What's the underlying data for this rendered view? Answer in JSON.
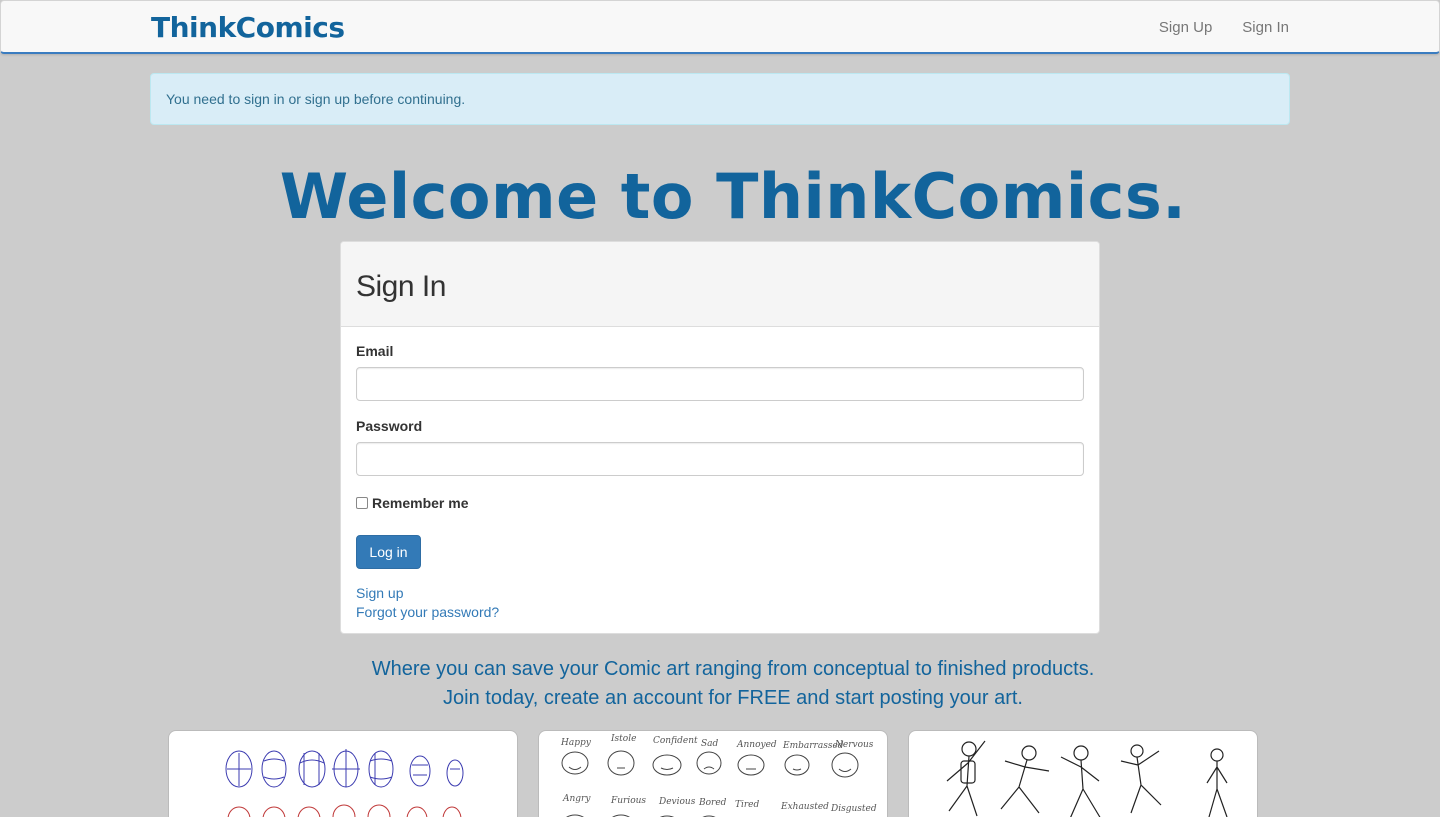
{
  "navbar": {
    "brand": "ThinkComics",
    "links": [
      {
        "label": "Sign Up"
      },
      {
        "label": "Sign In"
      }
    ]
  },
  "alert": {
    "message": "You need to sign in or sign up before continuing."
  },
  "headline": "Welcome to ThinkComics.",
  "sign_in": {
    "title": "Sign In",
    "email_label": "Email",
    "email_value": "",
    "password_label": "Password",
    "password_value": "",
    "remember_label": "Remember me",
    "remember_checked": false,
    "submit_label": "Log in",
    "signup_link": "Sign up",
    "forgot_link": "Forgot your password?"
  },
  "tagline": {
    "line1": "Where you can save your Comic art ranging from conceptual to finished products.",
    "line2": "Join today, create an account for FREE and start posting your art."
  },
  "gallery": {
    "card2_words_row1": [
      "Happy",
      "Istole",
      "Confident",
      "Sad",
      "Annoyed",
      "Embarrassed",
      "Nervous"
    ],
    "card2_words_row2": [
      "Angry",
      "Furious",
      "Devious",
      "Bored",
      "Tired",
      "Exhausted",
      "Disgusted"
    ]
  },
  "colors": {
    "brand": "#12649c",
    "primary_button": "#337ab7",
    "alert_bg": "#d9edf7",
    "page_bg": "#cccccc"
  }
}
